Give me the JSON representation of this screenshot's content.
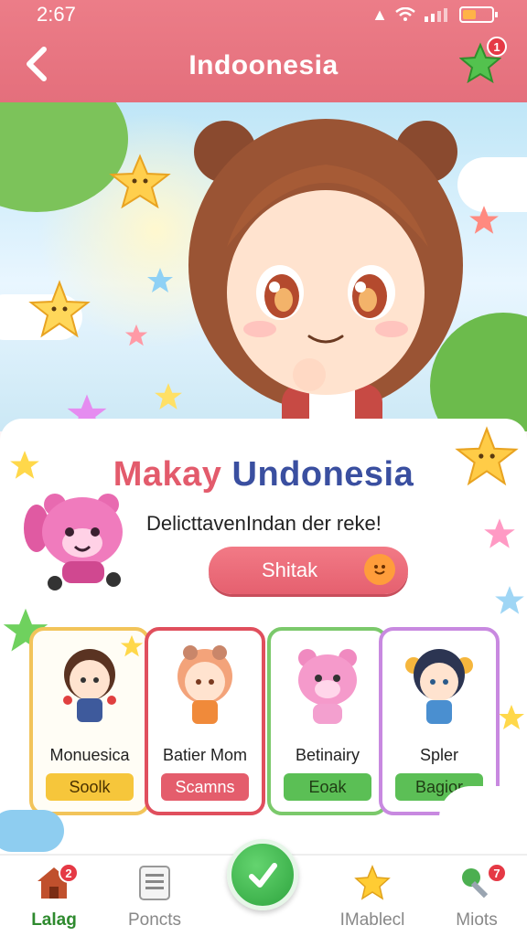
{
  "status_bar": {
    "time": "2:67",
    "signal_icon": "signal-icon",
    "wifi_icon": "wifi-icon",
    "battery_icon": "battery-icon"
  },
  "header": {
    "title": "Indoonesia",
    "back_icon": "chevron-left-icon",
    "star_icon": "star-icon",
    "star_badge": "1"
  },
  "banner": {
    "headline_part1": "Makay",
    "headline_part2": "Undonesia",
    "subtitle": "DelicttavenIndan der reke!",
    "cta_label": "Shitak"
  },
  "characters": [
    {
      "name": "Monuesica",
      "button": "Soolk",
      "border": "#f2c45a",
      "button_bg": "#f6c63b",
      "button_fg": "#4a3200"
    },
    {
      "name": "Batier Mom",
      "button": "Scamns",
      "border": "#e04f5d",
      "button_bg": "#e45d6c",
      "button_fg": "#ffffff"
    },
    {
      "name": "Betinairy",
      "button": "Eoak",
      "border": "#7bc96b",
      "button_bg": "#5bbf55",
      "button_fg": "#1f3d14"
    },
    {
      "name": "Spler",
      "button": "Bagior",
      "border": "#c889e0",
      "button_bg": "#5cbf56",
      "button_fg": "#1f3d14"
    }
  ],
  "bottom_nav": [
    {
      "label": "Lalag",
      "icon": "home-icon",
      "badge": "2",
      "active": true
    },
    {
      "label": "Poncts",
      "icon": "list-icon",
      "badge": "",
      "active": false
    },
    {
      "label": "IMablecl",
      "icon": "star-icon",
      "badge": "",
      "active": false
    },
    {
      "label": "Miots",
      "icon": "key-icon",
      "badge": "7",
      "active": false
    }
  ],
  "fab": {
    "icon": "checkmark-icon"
  },
  "colors": {
    "header": "#e8737f",
    "accent_red": "#e35b6c",
    "accent_blue": "#3a4fa0",
    "fab_green": "#3cb34a"
  }
}
